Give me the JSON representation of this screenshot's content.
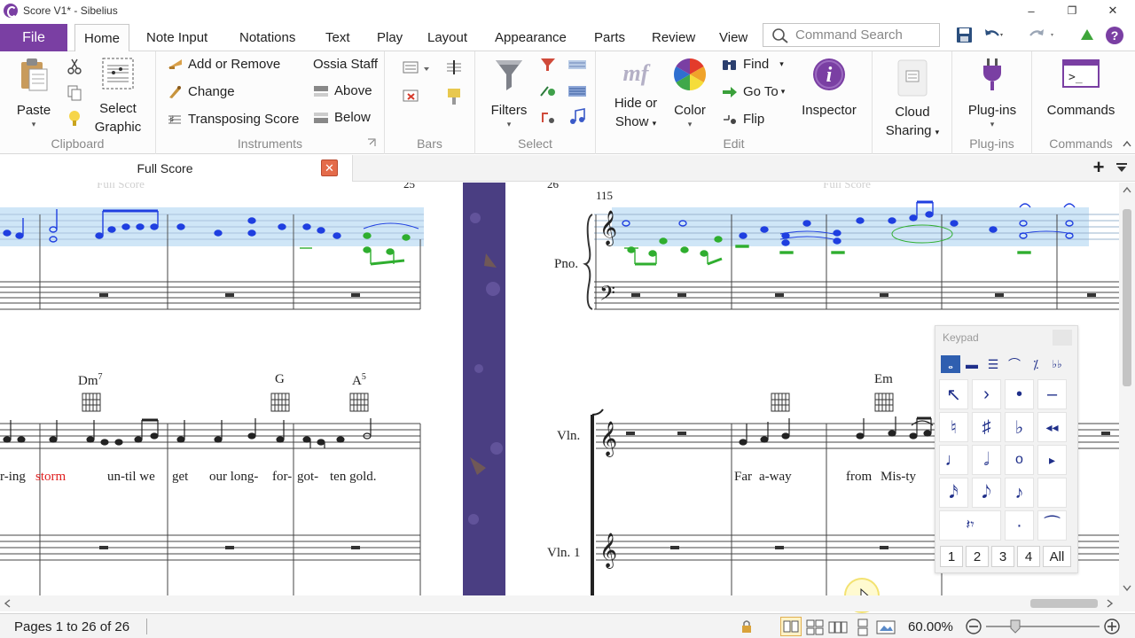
{
  "window": {
    "title": "Score V1* - Sibelius",
    "minimize": "–",
    "restore": "❐",
    "close": "✕"
  },
  "menu": {
    "file": "File",
    "tabs": [
      "Home",
      "Note Input",
      "Notations",
      "Text",
      "Play",
      "Layout",
      "Appearance",
      "Parts",
      "Review",
      "View"
    ],
    "active_tab": "Home",
    "search_placeholder": "Command Search"
  },
  "ribbon": {
    "clipboard": {
      "label": "Clipboard",
      "paste": "Paste",
      "select_graphic_1": "Select",
      "select_graphic_2": "Graphic"
    },
    "instruments": {
      "label": "Instruments",
      "add_remove": "Add or Remove",
      "change": "Change",
      "transposing": "Transposing Score",
      "ossia": "Ossia Staff",
      "above": "Above",
      "below": "Below"
    },
    "bars": {
      "label": "Bars"
    },
    "select": {
      "label": "Select",
      "filters": "Filters"
    },
    "edit": {
      "label": "Edit",
      "hide_show_1": "Hide or",
      "hide_show_2": "Show",
      "color": "Color",
      "find": "Find",
      "goto": "Go To",
      "flip": "Flip",
      "inspector": "Inspector"
    },
    "cloud": {
      "label_1": "Cloud",
      "label_2": "Sharing"
    },
    "plugins": {
      "label": "Plug-ins",
      "button": "Plug-ins"
    },
    "commands": {
      "label": "Commands",
      "button": "Commands"
    }
  },
  "document": {
    "tab_title": "Full Score",
    "close": "✕",
    "add": "+"
  },
  "score": {
    "left_page": {
      "header": "Full Score",
      "bar_number": "25"
    },
    "right_page": {
      "header": "Full Score",
      "page_number": "26",
      "bar_number": "115"
    },
    "instruments": [
      "Pno.",
      "Vln.",
      "Vln. 1"
    ],
    "chords_left": [
      "Dm",
      "G",
      "A"
    ],
    "chords_left_sup": [
      "7",
      "",
      "5"
    ],
    "chords_right": [
      "Em"
    ],
    "lyrics_left": [
      "r-ing",
      "storm",
      "un-til we",
      "get",
      "our long-",
      "for-",
      "got-",
      "ten gold."
    ],
    "lyrics_right": [
      "Far",
      "a-way",
      "from",
      "Mis-ty"
    ]
  },
  "keypad": {
    "title": "Keypad",
    "tabs": [
      "𝅝",
      "▬",
      "☰",
      "⌒",
      "⁒",
      "♭♭"
    ],
    "keys": [
      "↖",
      "›",
      "•",
      "–",
      "♮",
      "♯",
      "♭",
      "◂◂",
      "♩",
      "𝅗𝅥",
      "o",
      "▸",
      "𝅘𝅥𝅯",
      "𝅘𝅥𝅮",
      "♪",
      "",
      "𝄽𝄾",
      "·",
      "⁀"
    ],
    "layouts": [
      "1",
      "2",
      "3",
      "4",
      "All"
    ]
  },
  "status": {
    "pages": "Pages 1 to 26 of 26",
    "zoom": "60.00%"
  },
  "colors": {
    "accent": "#7a3fa3",
    "selection": "#cfe6f7",
    "selected_notes": "#1f3fe0",
    "input_notes": "#2fae2f",
    "lyric_highlight": "#e02020"
  }
}
